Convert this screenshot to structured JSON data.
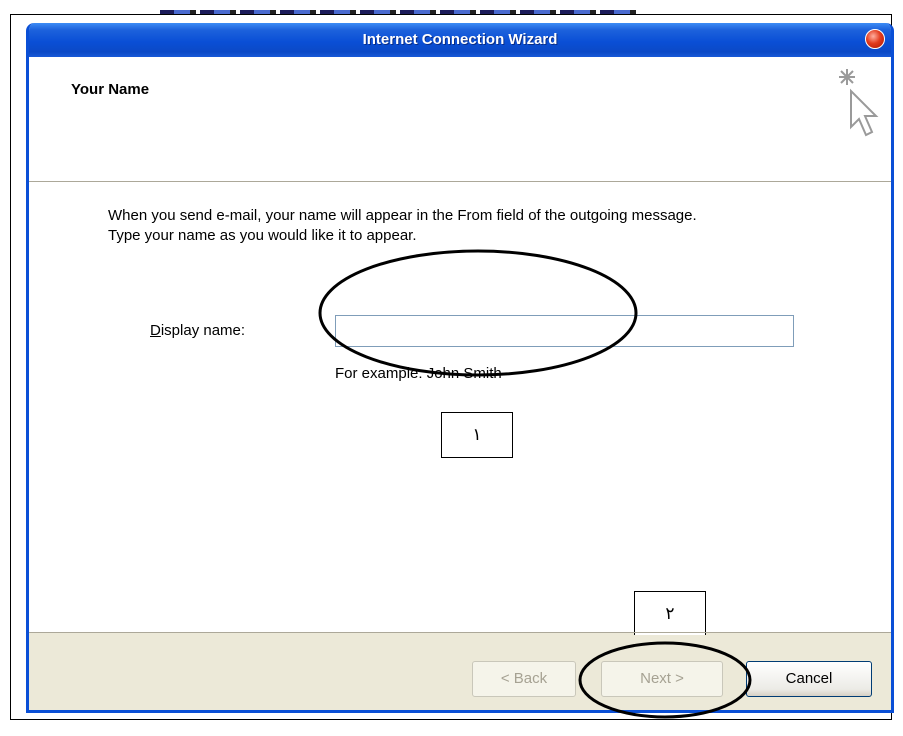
{
  "window": {
    "title": "Internet Connection Wizard"
  },
  "header": {
    "title": "Your Name"
  },
  "body": {
    "intro_line1": "When you send e-mail, your name will appear in the From field of the outgoing message.",
    "intro_line2": "Type your name as you would like it to appear.",
    "display_name_label": "Display name:",
    "display_name_value": "",
    "example_text": "For example: John Smith"
  },
  "annotations": {
    "box1": "١",
    "box2": "٢"
  },
  "buttons": {
    "back": "< Back",
    "next": "Next >",
    "cancel": "Cancel"
  },
  "icons": {
    "wizard": "wizard-cursor-icon",
    "close": "close-icon"
  },
  "colors": {
    "titlebar": "#0a4fd6",
    "window_bg": "#ece9d8",
    "close": "#e23b1e"
  }
}
